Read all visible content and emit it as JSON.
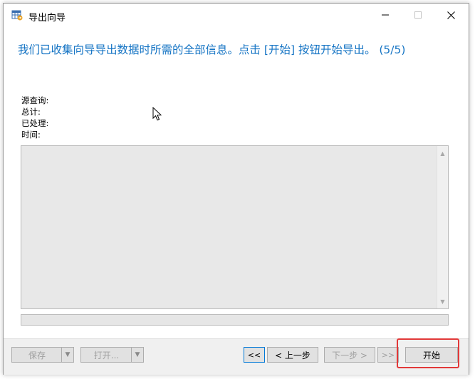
{
  "window": {
    "title": "导出向导"
  },
  "heading": "我们已收集向导导出数据时所需的全部信息。点击 [开始] 按钮开始导出。 (5/5)",
  "info": {
    "source_query": "源查询:",
    "total": "总计:",
    "processed": "已处理:",
    "time": "时间:"
  },
  "footer": {
    "save_label": "保存",
    "open_label": "打开...",
    "first_label": "<<",
    "prev_label": "< 上一步",
    "next_label": "下一步 >",
    "last_label": ">>",
    "start_label": "开始"
  },
  "colors": {
    "heading": "#1574c4",
    "highlight": "#e23838",
    "focus": "#0078d7"
  },
  "icons": {
    "app": "table-export-icon",
    "cursor": "mouse-pointer-icon"
  }
}
